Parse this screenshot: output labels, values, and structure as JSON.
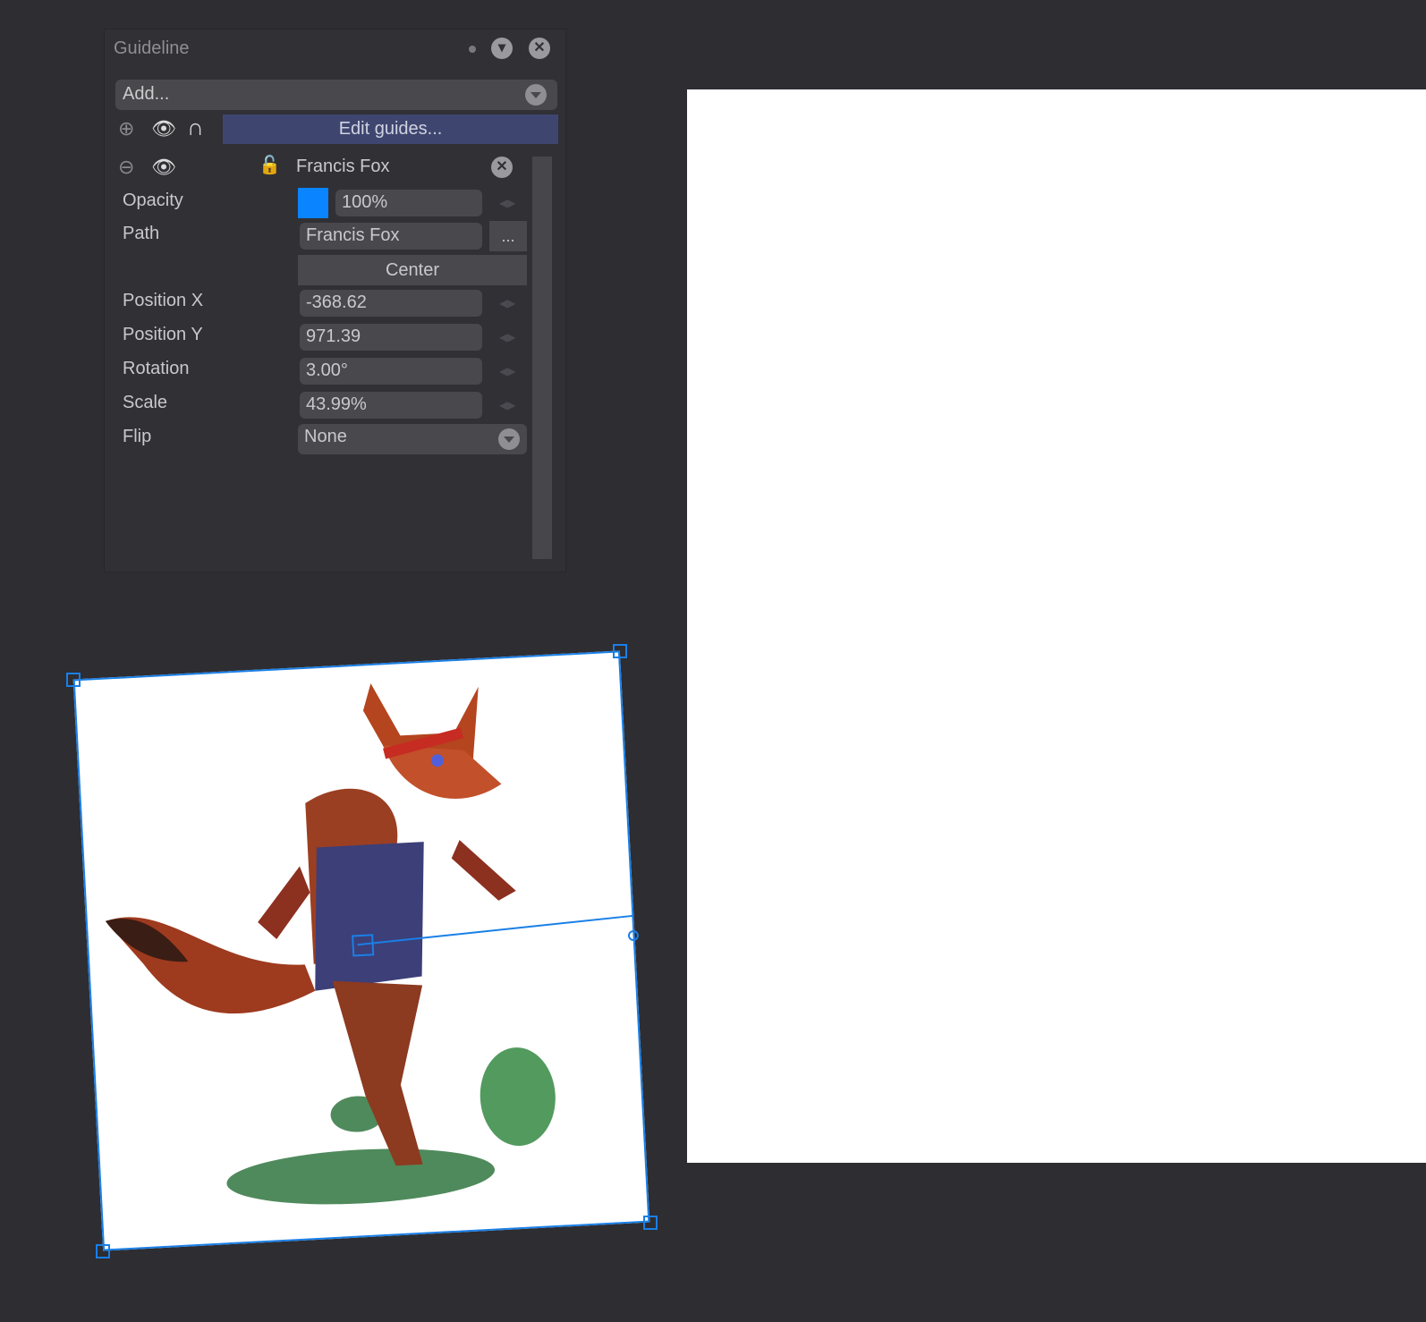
{
  "panel": {
    "title": "Guideline",
    "add_placeholder": "Add...",
    "edit_guides": "Edit guides..."
  },
  "layer": {
    "name": "Francis Fox",
    "labels": {
      "opacity": "Opacity",
      "path": "Path",
      "position_x": "Position X",
      "position_y": "Position Y",
      "rotation": "Rotation",
      "scale": "Scale",
      "flip": "Flip"
    },
    "opacity": "100%",
    "opacity_color": "#0a84ff",
    "path": "Francis Fox",
    "path_browse": "...",
    "center": "Center",
    "position_x": "-368.62",
    "position_y": "971.39",
    "rotation": "3.00°",
    "scale": "43.99%",
    "flip": "None"
  }
}
